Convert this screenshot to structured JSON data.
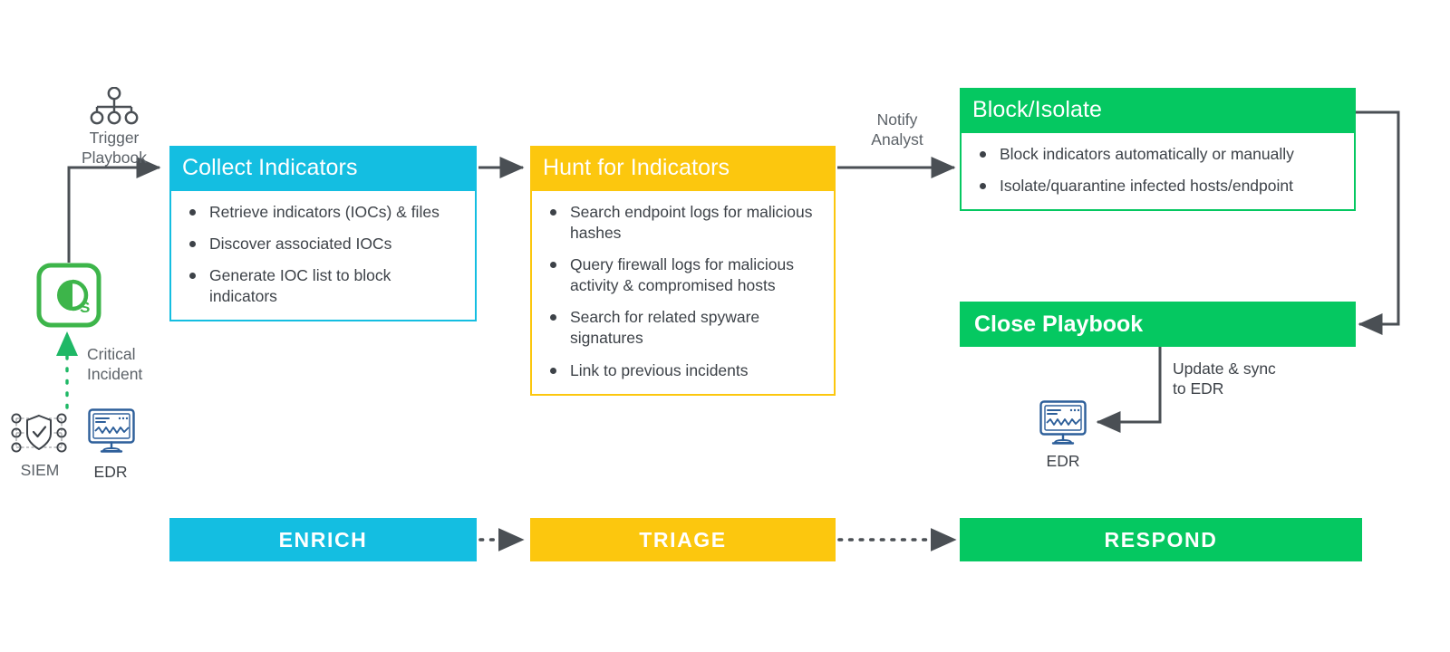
{
  "diagram": {
    "title": "Spyware Incident Response Playbook Flow",
    "colors": {
      "enrich": "#14BEE1",
      "triage": "#FCC70E",
      "respond": "#05C861",
      "connector": "#4a4f54",
      "text": "#3d4248",
      "muted": "#5c6268",
      "edr_blue": "#2d5f9a"
    }
  },
  "sources": {
    "siem": {
      "label": "SIEM",
      "icon": "shield-network-icon"
    },
    "edr": {
      "label": "EDR",
      "icon": "monitor-waveform-icon"
    },
    "platform": {
      "icon": "soar-platform-logo"
    },
    "critical_incident_label": "Critical\nIncident",
    "trigger": {
      "icon": "org-hierarchy-icon",
      "label": "Trigger\nPlaybook"
    }
  },
  "cards": [
    {
      "id": "collect-indicators",
      "title": "Collect Indicators",
      "color": "cyan",
      "items": [
        "Retrieve indicators (IOCs) & files",
        "Discover associated IOCs",
        "Generate IOC list to block indicators"
      ]
    },
    {
      "id": "hunt-for-indicators",
      "title": "Hunt for Indicators",
      "color": "amber",
      "items": [
        "Search endpoint logs for malicious hashes",
        "Query firewall logs for malicious activity & compromised hosts",
        "Search for related spyware signatures",
        "Link to previous incidents"
      ]
    },
    {
      "id": "block-isolate",
      "title": "Block/Isolate",
      "color": "green",
      "items": [
        "Block indicators automatically or manually",
        "Isolate/quarantine infected hosts/endpoint"
      ]
    }
  ],
  "close_playbook": {
    "title": "Close Playbook",
    "color": "green"
  },
  "connector_labels": {
    "notify_analyst": "Notify\nAnalyst",
    "update_sync": "Update & sync\nto EDR"
  },
  "edr_sink": {
    "label": "EDR",
    "icon": "monitor-waveform-icon"
  },
  "phases": [
    {
      "id": "enrich",
      "label": "ENRICH",
      "color": "cyan"
    },
    {
      "id": "triage",
      "label": "TRIAGE",
      "color": "amber"
    },
    {
      "id": "respond",
      "label": "RESPOND",
      "color": "green"
    }
  ]
}
